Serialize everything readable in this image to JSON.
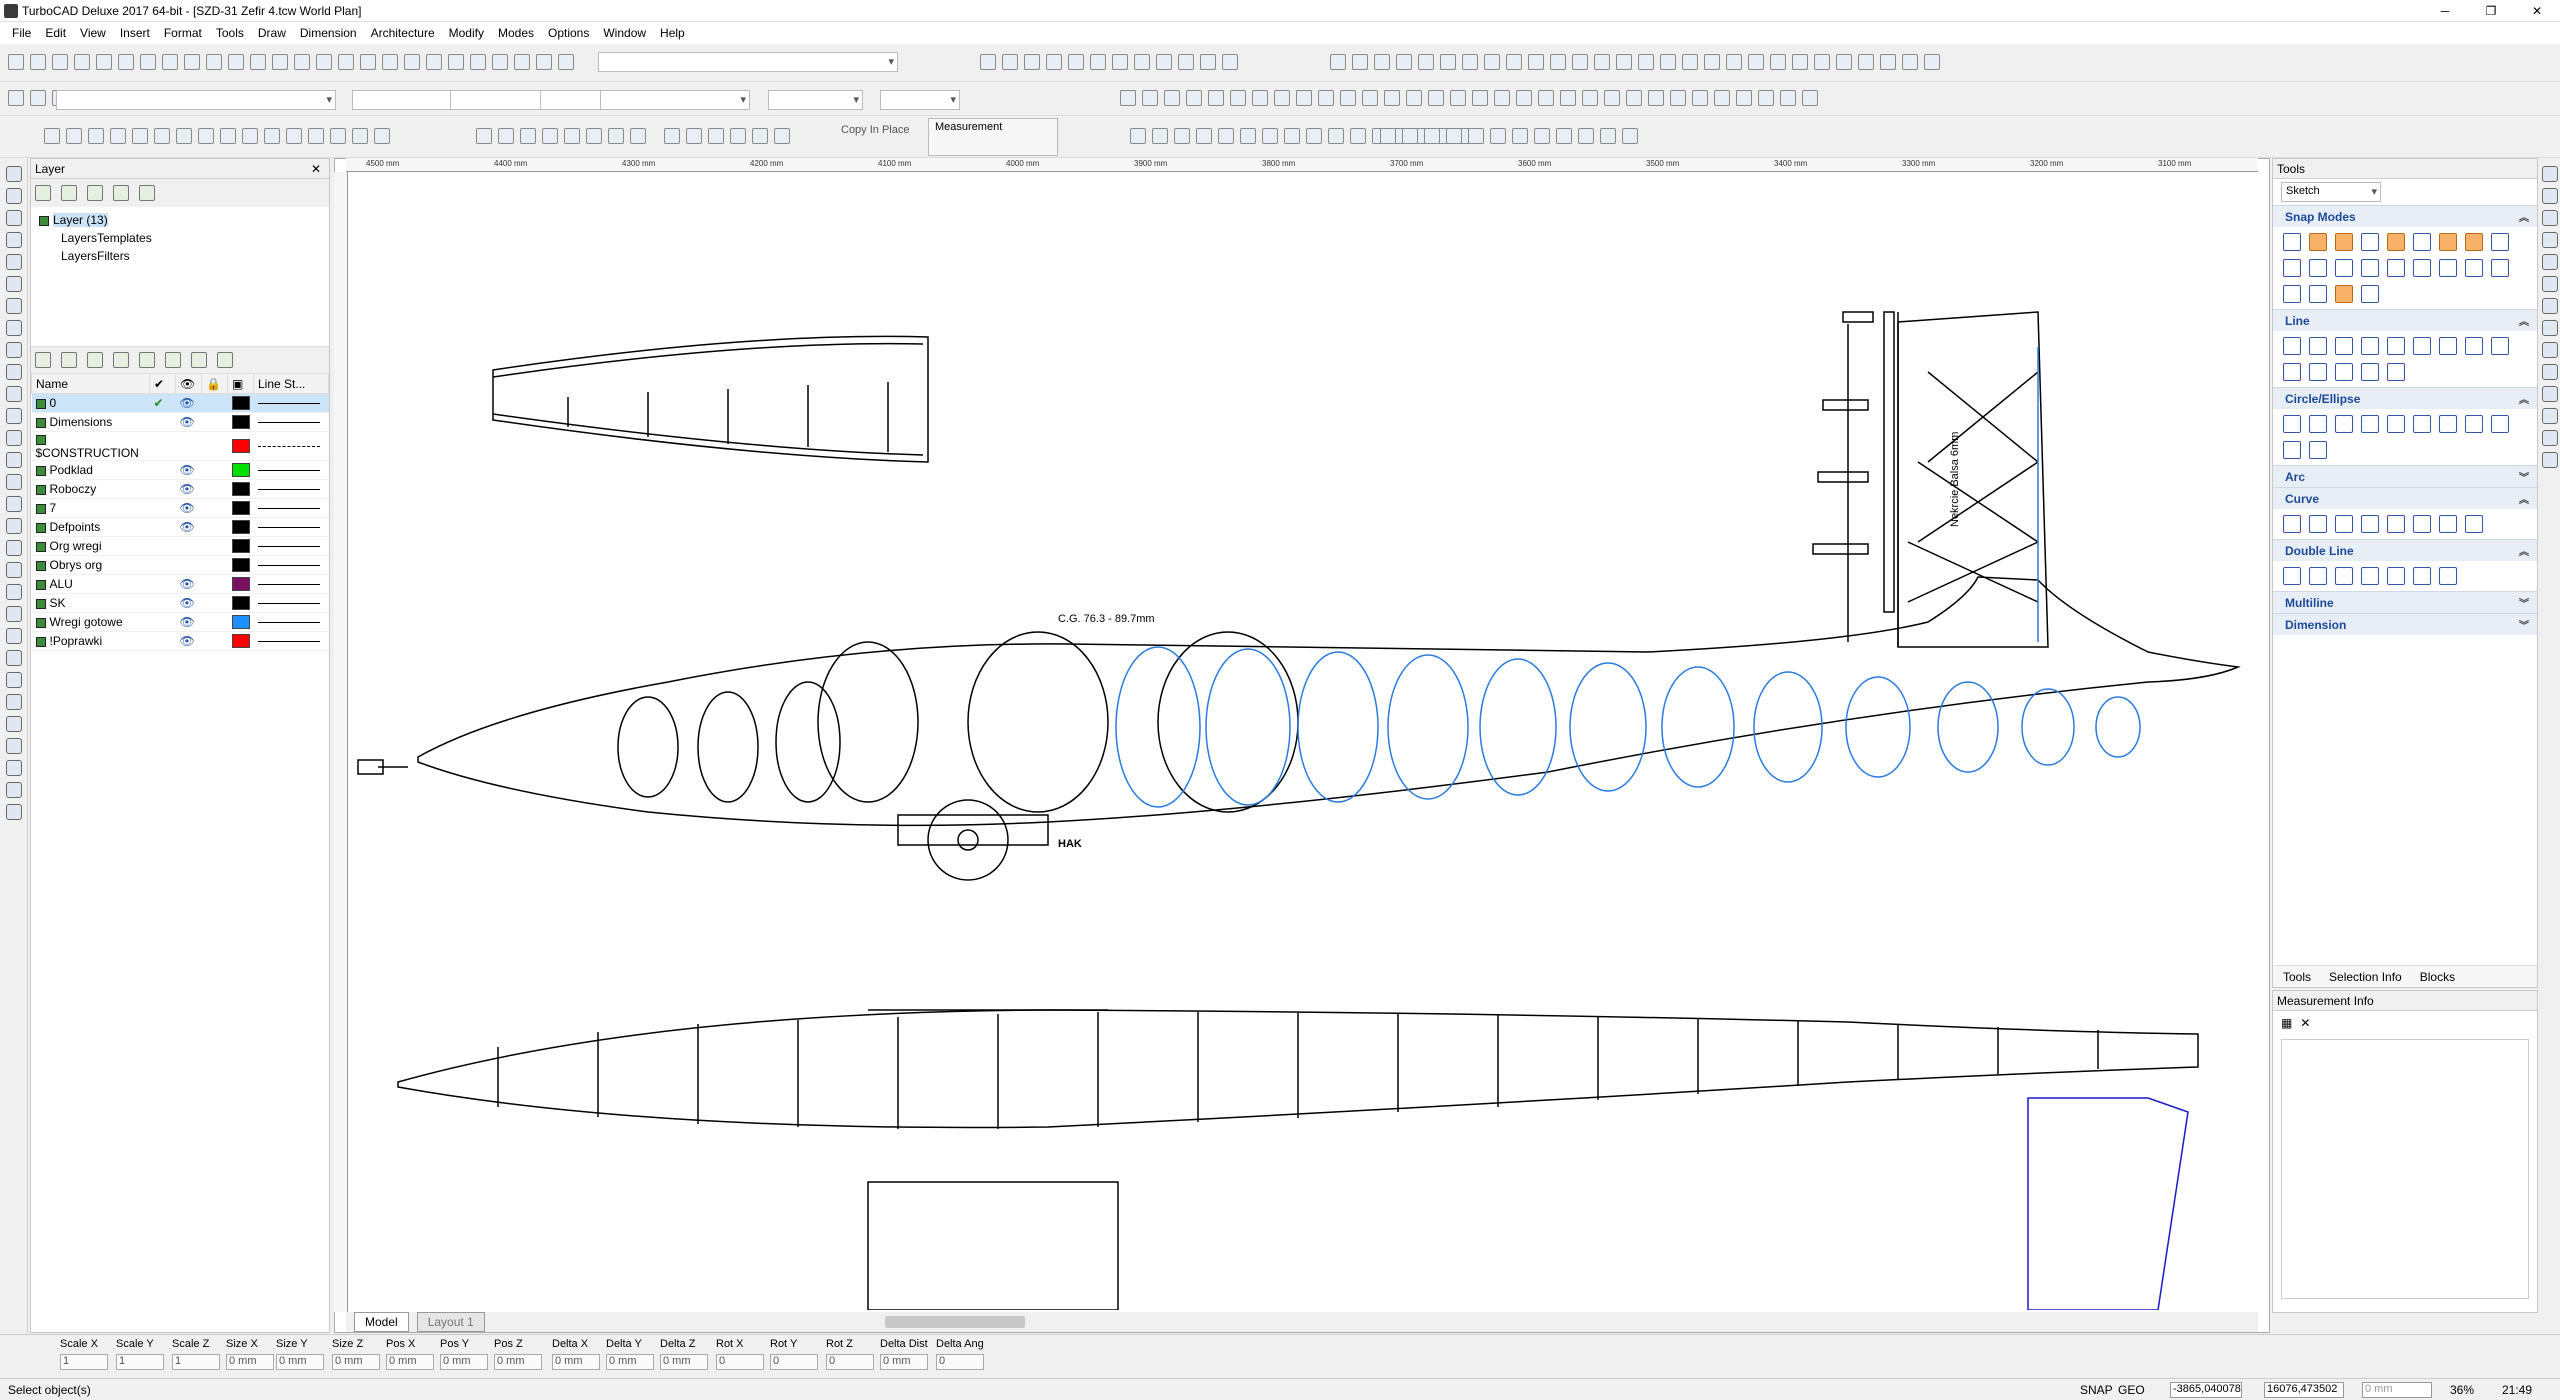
{
  "window": {
    "title": "TurboCAD Deluxe 2017 64-bit - [SZD-31 Zefir 4.tcw World Plan]"
  },
  "menu": [
    "File",
    "Edit",
    "View",
    "Insert",
    "Format",
    "Tools",
    "Draw",
    "Dimension",
    "Architecture",
    "Modify",
    "Modes",
    "Options",
    "Window",
    "Help"
  ],
  "toolbar": {
    "copy_in_place": "Copy In Place",
    "measurement_label": "Measurement"
  },
  "layer_panel": {
    "title": "Layer",
    "tree": {
      "root": "Layer (13)",
      "children": [
        "LayersTemplates",
        "LayersFilters"
      ]
    },
    "columns": {
      "name": "Name",
      "line_style": "Line St..."
    },
    "layers": [
      {
        "name": "0",
        "current": true,
        "visible": true,
        "color": "#000000",
        "dashed": false
      },
      {
        "name": "Dimensions",
        "current": false,
        "visible": true,
        "color": "#000000",
        "dashed": false
      },
      {
        "name": "$CONSTRUCTION",
        "current": false,
        "visible": false,
        "color": "#ff0000",
        "dashed": true
      },
      {
        "name": "Podklad",
        "current": false,
        "visible": true,
        "color": "#00e000",
        "dashed": false
      },
      {
        "name": "Roboczy",
        "current": false,
        "visible": true,
        "color": "#000000",
        "dashed": false
      },
      {
        "name": "7",
        "current": false,
        "visible": true,
        "color": "#000000",
        "dashed": false
      },
      {
        "name": "Defpoints",
        "current": false,
        "visible": true,
        "color": "#000000",
        "dashed": false
      },
      {
        "name": "Org wregi",
        "current": false,
        "visible": false,
        "color": "#000000",
        "dashed": false
      },
      {
        "name": "Obrys org",
        "current": false,
        "visible": false,
        "color": "#000000",
        "dashed": false
      },
      {
        "name": "ALU",
        "current": false,
        "visible": true,
        "color": "#7a1060",
        "dashed": false
      },
      {
        "name": "SK",
        "current": false,
        "visible": true,
        "color": "#000000",
        "dashed": false
      },
      {
        "name": "Wregi gotowe",
        "current": false,
        "visible": true,
        "color": "#1e90ff",
        "dashed": false
      },
      {
        "name": "!Poprawki",
        "current": false,
        "visible": true,
        "color": "#ff0000",
        "dashed": false
      }
    ]
  },
  "ruler": {
    "labels": [
      "4500 mm",
      "4400 mm",
      "4300 mm",
      "4200 mm",
      "4100 mm",
      "4000 mm",
      "3900 mm",
      "3800 mm",
      "3700 mm",
      "3600 mm",
      "3500 mm",
      "3400 mm",
      "3300 mm",
      "3200 mm",
      "3100 mm"
    ]
  },
  "drawing": {
    "cg_label": "C.G. 76.3 - 89.7mm",
    "hak_label": "HAK",
    "balsa_label": "Nekrcie Balsa 6mm"
  },
  "tools_panel": {
    "title": "Tools",
    "mode": "Sketch",
    "sections": [
      {
        "name": "Snap Modes",
        "open": true,
        "icons": 22
      },
      {
        "name": "Line",
        "open": true,
        "icons": 14
      },
      {
        "name": "Circle/Ellipse",
        "open": true,
        "icons": 11
      },
      {
        "name": "Arc",
        "open": false,
        "icons": 0
      },
      {
        "name": "Curve",
        "open": true,
        "icons": 8
      },
      {
        "name": "Double Line",
        "open": true,
        "icons": 7
      },
      {
        "name": "Multiline",
        "open": false,
        "icons": 0
      },
      {
        "name": "Dimension",
        "open": false,
        "icons": 0
      }
    ],
    "tabs": [
      "Tools",
      "Selection Info",
      "Blocks"
    ]
  },
  "measurement_info": {
    "title": "Measurement Info"
  },
  "layout_tabs": [
    "Model",
    "Layout 1"
  ],
  "inspector": [
    {
      "label": "Scale X",
      "value": "1"
    },
    {
      "label": "Scale Y",
      "value": "1"
    },
    {
      "label": "Scale Z",
      "value": "1"
    },
    {
      "label": "Size X",
      "value": "0 mm"
    },
    {
      "label": "Size Y",
      "value": "0 mm"
    },
    {
      "label": "Size Z",
      "value": "0 mm"
    },
    {
      "label": "Pos X",
      "value": "0 mm"
    },
    {
      "label": "Pos Y",
      "value": "0 mm"
    },
    {
      "label": "Pos Z",
      "value": "0 mm"
    },
    {
      "label": "Delta X",
      "value": "0 mm"
    },
    {
      "label": "Delta Y",
      "value": "0 mm"
    },
    {
      "label": "Delta Z",
      "value": "0 mm"
    },
    {
      "label": "Rot X",
      "value": "0"
    },
    {
      "label": "Rot Y",
      "value": "0"
    },
    {
      "label": "Rot Z",
      "value": "0"
    },
    {
      "label": "Delta Dist",
      "value": "0 mm"
    },
    {
      "label": "Delta Ang",
      "value": "0"
    }
  ],
  "status": {
    "message": "Select object(s)",
    "snap": "SNAP",
    "geo": "GEO",
    "x": "-3865,040078",
    "y": "16076,473502",
    "z": "0 mm",
    "zoom": "36%",
    "time": "21:49"
  }
}
